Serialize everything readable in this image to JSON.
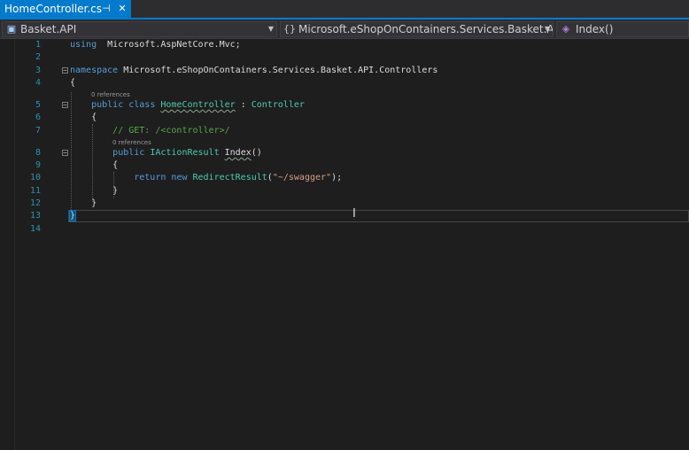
{
  "tab": {
    "filename": "HomeController.cs",
    "pin_glyph": "⊣",
    "close_glyph": "✕"
  },
  "nav": {
    "project": "Basket.API",
    "type_scope": "Microsoft.eShopOnContainers.Services.Basket.API.C",
    "member": "Index()"
  },
  "editor": {
    "codelens_class": "0 references",
    "codelens_method": "0 references",
    "lines": [
      {
        "n": "1",
        "parts": [
          [
            "kw",
            "using"
          ],
          [
            "",
            "  Microsoft.AspNetCore.Mvc;"
          ]
        ]
      },
      {
        "n": "2",
        "parts": []
      },
      {
        "n": "3",
        "parts": [
          [
            "kw",
            "namespace"
          ],
          [
            "",
            " Microsoft.eShopOnContainers.Services.Basket.API.Controllers"
          ]
        ]
      },
      {
        "n": "4",
        "parts": [
          [
            "",
            "{"
          ]
        ]
      },
      {
        "n": "5",
        "parts": [
          [
            "",
            "    "
          ],
          [
            "kw",
            "public"
          ],
          [
            "",
            " "
          ],
          [
            "kw",
            "class"
          ],
          [
            "",
            " "
          ],
          [
            "ty squig",
            "HomeController"
          ],
          [
            "",
            " : "
          ],
          [
            "ty",
            "Controller"
          ]
        ]
      },
      {
        "n": "6",
        "parts": [
          [
            "",
            "    {"
          ]
        ]
      },
      {
        "n": "7",
        "parts": [
          [
            "",
            "        "
          ],
          [
            "cm",
            "// GET: /<controller>/"
          ]
        ]
      },
      {
        "n": "8",
        "parts": [
          [
            "",
            "        "
          ],
          [
            "kw",
            "public"
          ],
          [
            "",
            " "
          ],
          [
            "ty",
            "IActionResult"
          ],
          [
            "",
            " "
          ],
          [
            "squig",
            "Index"
          ],
          [
            "",
            "()"
          ]
        ]
      },
      {
        "n": "9",
        "parts": [
          [
            "",
            "        {"
          ]
        ]
      },
      {
        "n": "10",
        "parts": [
          [
            "",
            "            "
          ],
          [
            "kw",
            "return"
          ],
          [
            "",
            " "
          ],
          [
            "kw",
            "new"
          ],
          [
            "",
            " "
          ],
          [
            "ty",
            "RedirectResult"
          ],
          [
            "",
            "("
          ],
          [
            "st",
            "\"~/swagger\""
          ],
          [
            "",
            ");"
          ]
        ]
      },
      {
        "n": "11",
        "parts": [
          [
            "",
            "        }"
          ]
        ]
      },
      {
        "n": "12",
        "parts": [
          [
            "",
            "    }"
          ]
        ]
      },
      {
        "n": "13",
        "parts": [
          [
            "bm",
            "}"
          ]
        ]
      },
      {
        "n": "14",
        "parts": []
      }
    ]
  },
  "colors": {
    "accent": "#007acc",
    "line_number": "#2b91af",
    "keyword": "#569cd6",
    "type": "#4ec9b0",
    "comment": "#57a64a",
    "string": "#d69d85",
    "text": "#dcdcdc",
    "background": "#1e1e1e"
  },
  "icons": {
    "project": "csharp-project-icon",
    "scope": "namespace-icon",
    "member": "method-icon",
    "cursor": "i-beam-cursor-icon"
  }
}
